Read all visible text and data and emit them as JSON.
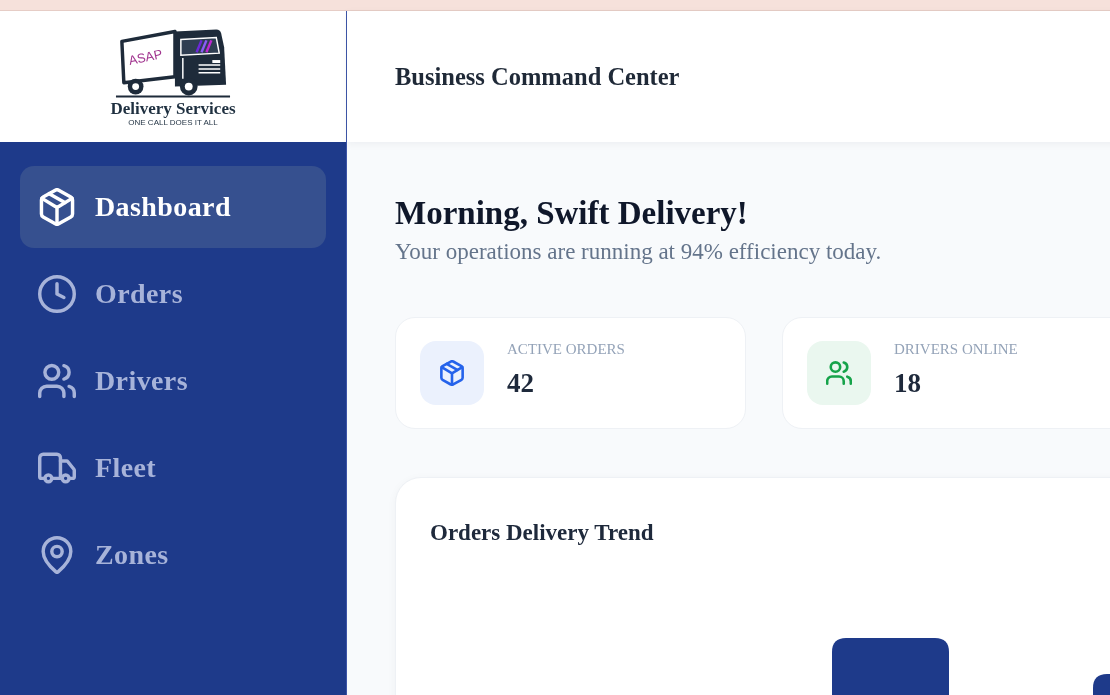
{
  "logo": {
    "badge": "ASAP",
    "name": "Delivery Services",
    "tagline": "ONE CALL DOES IT ALL"
  },
  "sidebar": {
    "items": [
      {
        "label": "Dashboard",
        "selected": true
      },
      {
        "label": "Orders",
        "selected": false
      },
      {
        "label": "Drivers",
        "selected": false
      },
      {
        "label": "Fleet",
        "selected": false
      },
      {
        "label": "Zones",
        "selected": false
      }
    ]
  },
  "header": {
    "title": "Business Command Center"
  },
  "greeting": {
    "title": "Morning, Swift Delivery!",
    "subtitle": "Your operations are running at 94% efficiency today."
  },
  "stats": [
    {
      "label": "ACTIVE ORDERS",
      "value": "42",
      "color": "#2563eb"
    },
    {
      "label": "DRIVERS ONLINE",
      "value": "18",
      "color": "#16a34a"
    }
  ],
  "chart": {
    "title": "Orders Delivery Trend"
  }
}
